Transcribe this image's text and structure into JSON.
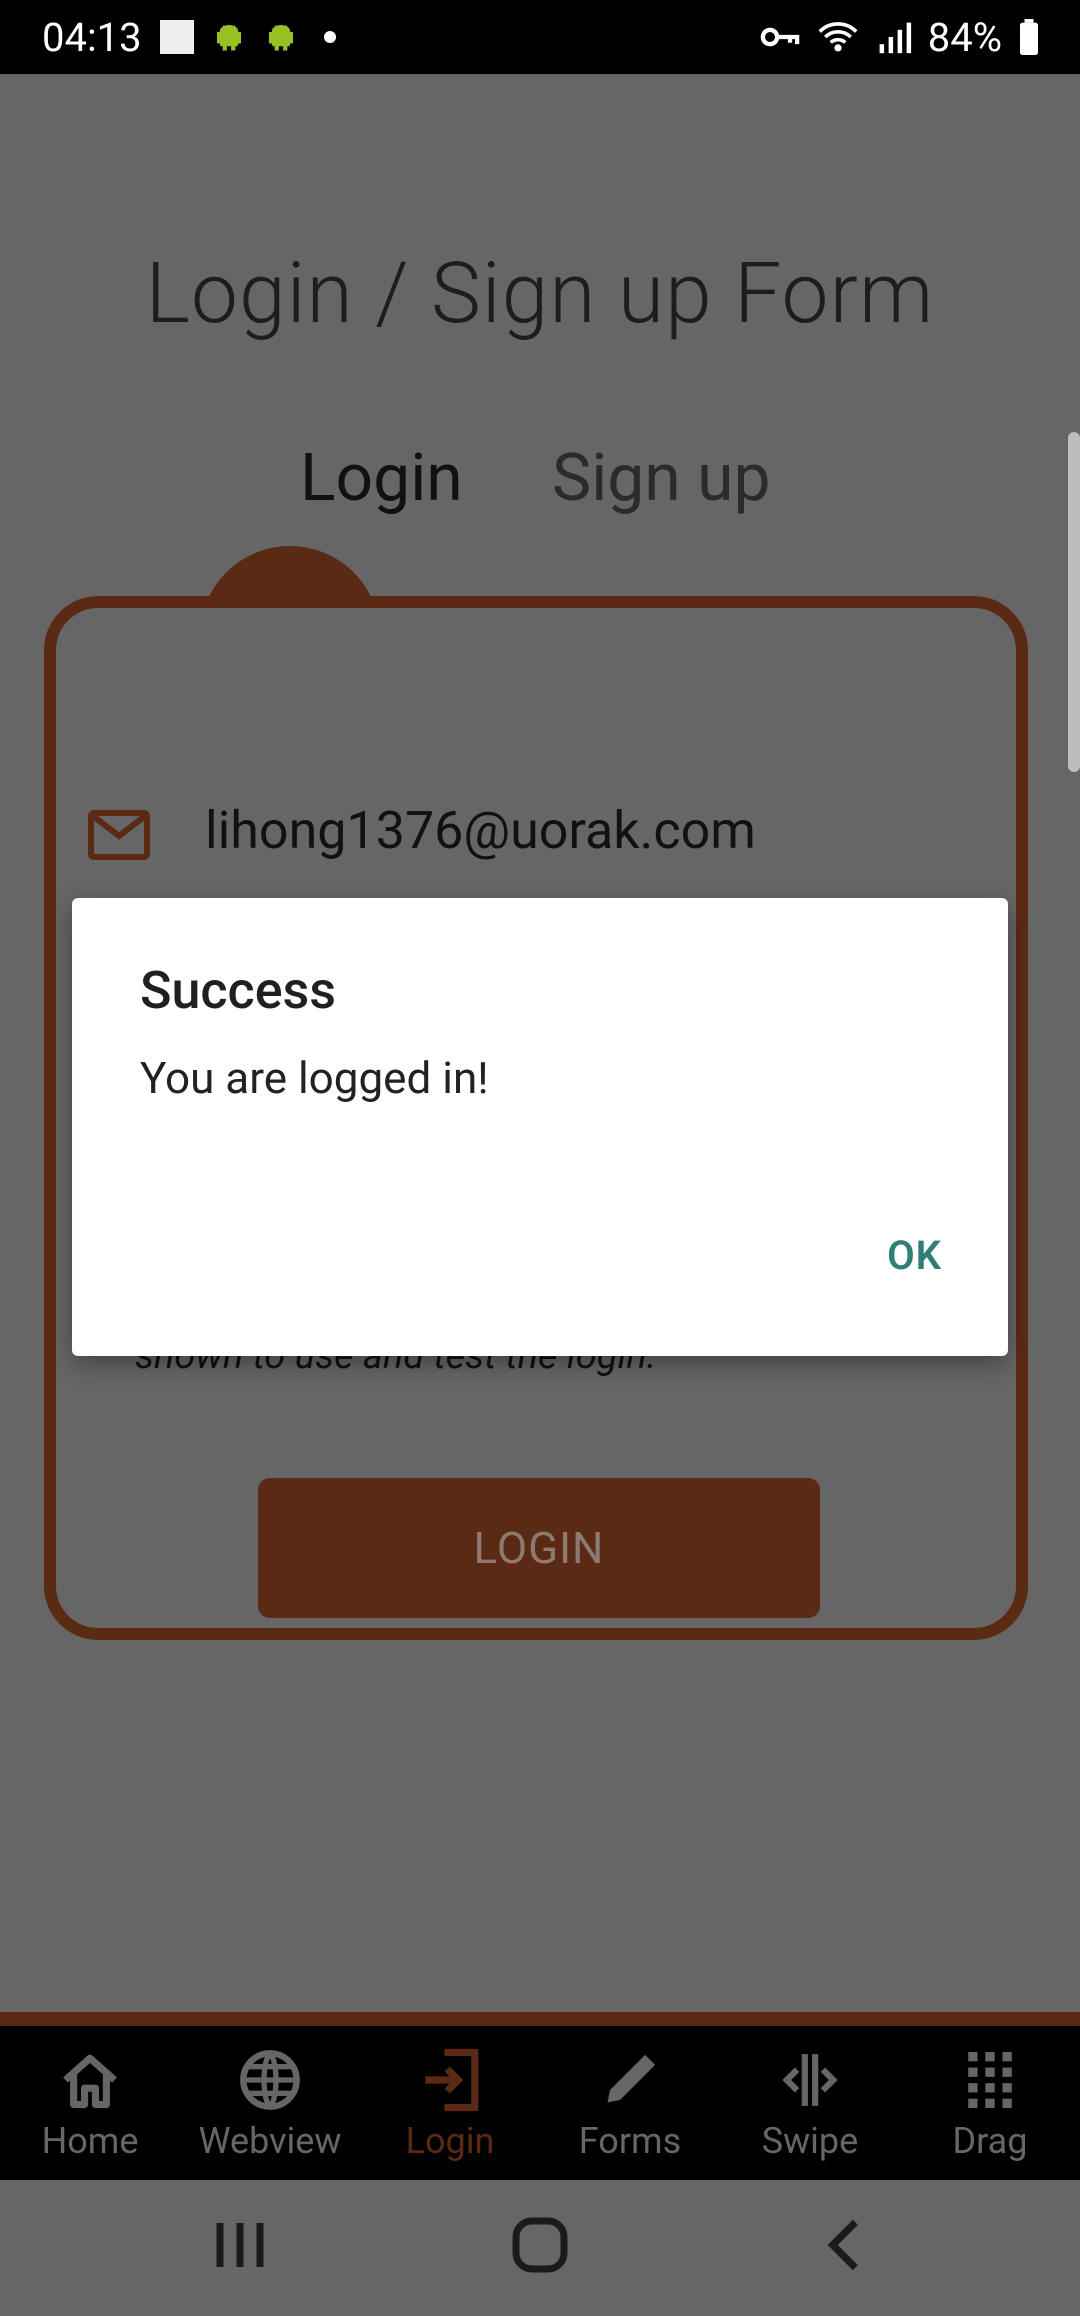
{
  "status_bar": {
    "time": "04:13",
    "battery": "84%",
    "icons": [
      "square-icon",
      "android-icon",
      "android-icon",
      "dot-icon",
      "key-icon",
      "wifi-icon",
      "signal-icon",
      "battery-icon"
    ]
  },
  "page": {
    "title": "Login / Sign up Form",
    "tabs": [
      {
        "label": "Login",
        "active": true
      },
      {
        "label": "Sign up",
        "active": false
      }
    ]
  },
  "form": {
    "email_value": "lihong1376@uorak.com",
    "helper_text": "shown to use and test the login.",
    "login_button": "LOGIN"
  },
  "dialog": {
    "title": "Success",
    "message": "You are logged in!",
    "ok_label": "OK"
  },
  "bottom_nav": {
    "items": [
      {
        "label": "Home",
        "icon": "home-icon"
      },
      {
        "label": "Webview",
        "icon": "globe-icon"
      },
      {
        "label": "Login",
        "icon": "login-icon",
        "active": true
      },
      {
        "label": "Forms",
        "icon": "pencil-icon"
      },
      {
        "label": "Swipe",
        "icon": "swipe-icon"
      },
      {
        "label": "Drag",
        "icon": "grid-icon"
      }
    ]
  },
  "colors": {
    "accent": "#5b2a14",
    "dialog_button": "#2f7f78",
    "scrim": "#666666"
  }
}
